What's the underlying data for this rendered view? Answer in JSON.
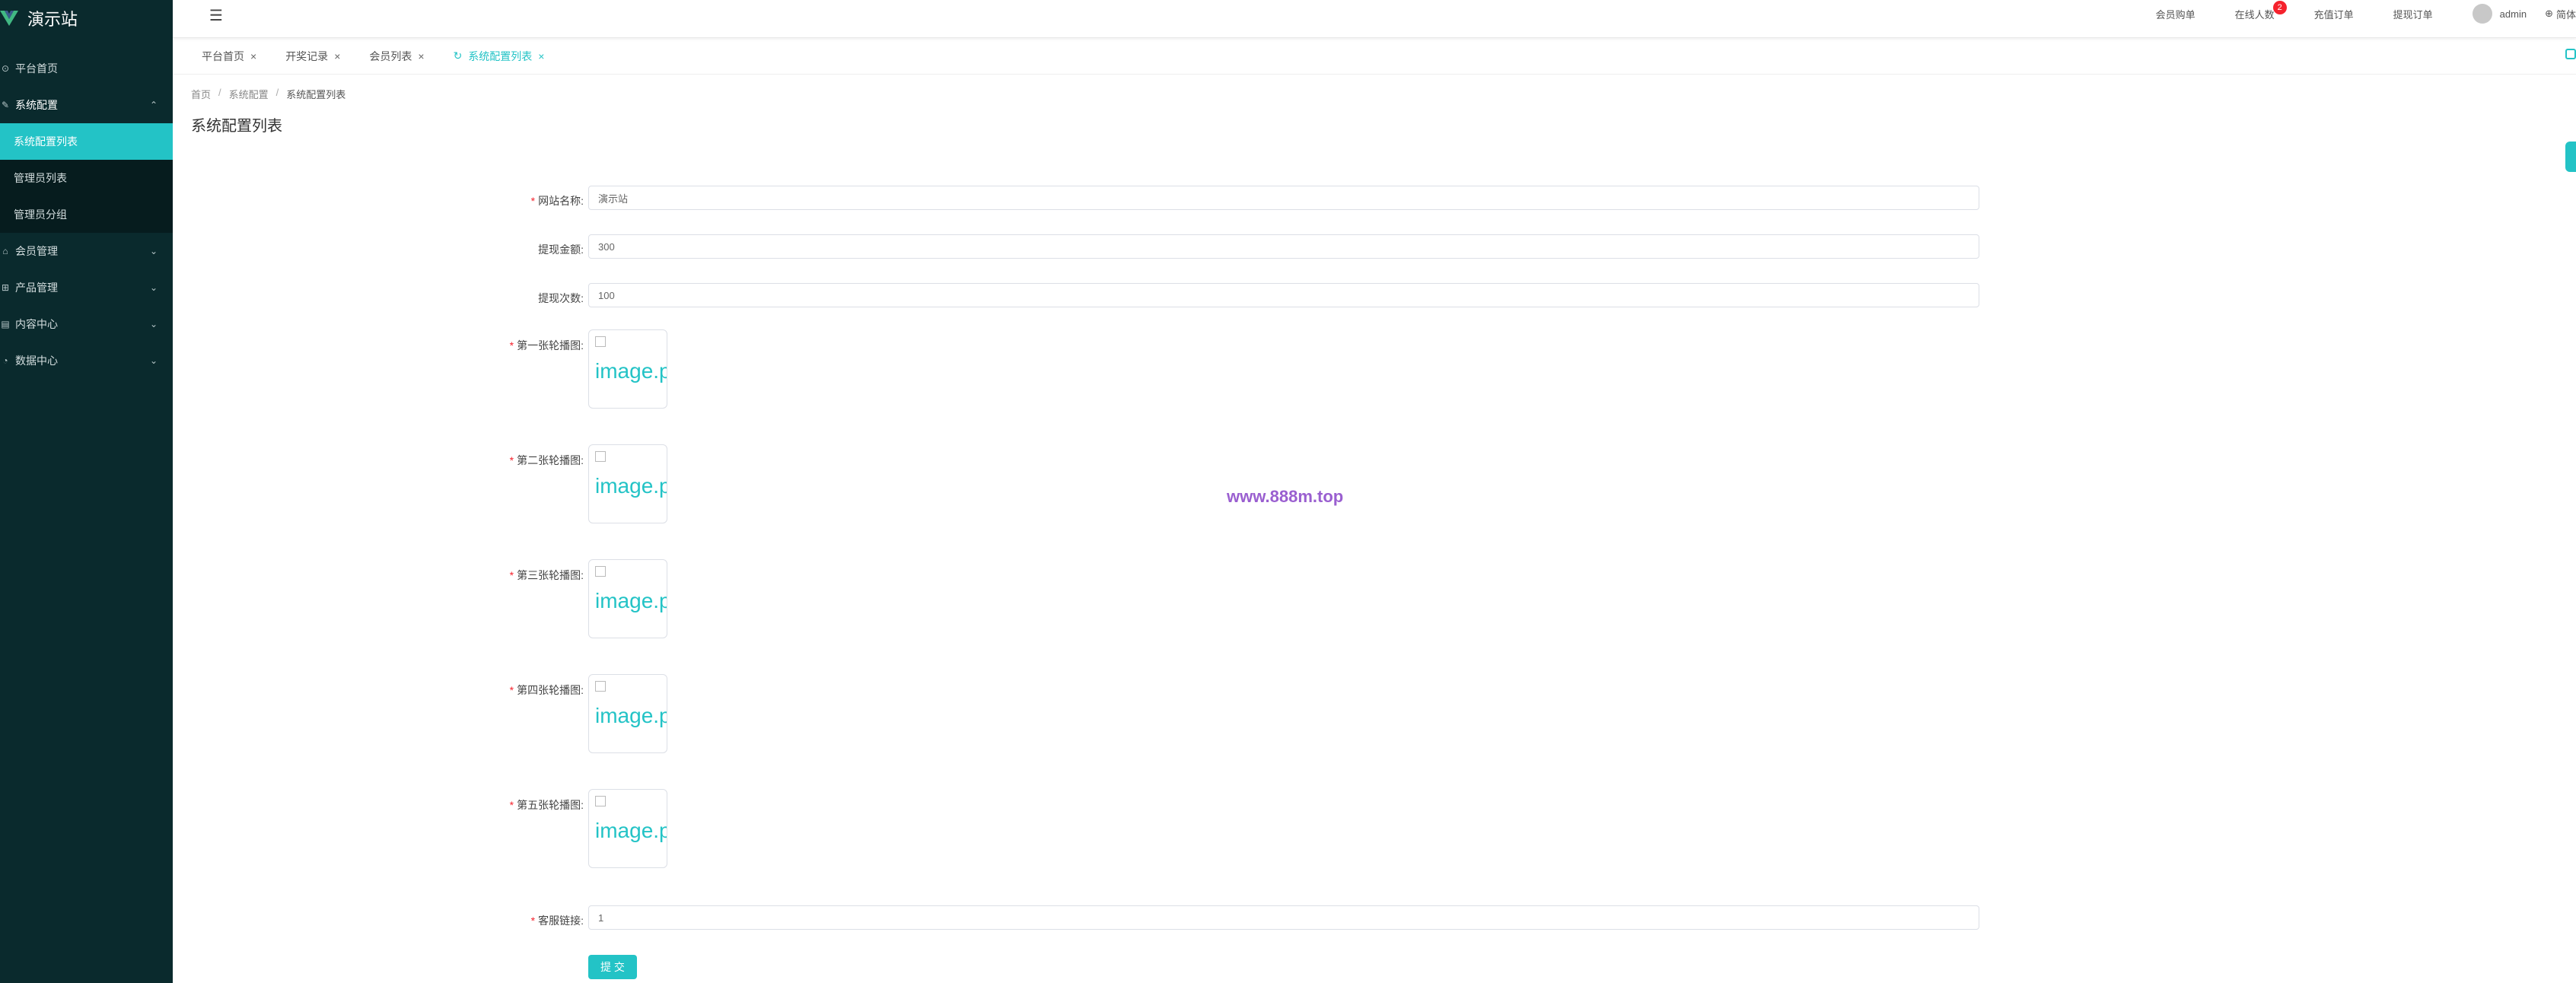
{
  "sidebar": {
    "title": "演示站",
    "items": [
      {
        "label": "平台首页",
        "icon": "home-icon"
      },
      {
        "label": "系统配置",
        "icon": "edit-icon"
      },
      {
        "label": "会员管理",
        "icon": "user-icon"
      },
      {
        "label": "产品管理",
        "icon": "grid-icon"
      },
      {
        "label": "内容中心",
        "icon": "document-icon"
      },
      {
        "label": "数据中心",
        "icon": "chart-icon"
      }
    ],
    "sub_items": [
      {
        "label": "系统配置列表"
      },
      {
        "label": "管理员列表"
      },
      {
        "label": "管理员分组"
      }
    ]
  },
  "header": {
    "links": [
      "会员购单",
      "在线人数",
      "充值订单",
      "提现订单"
    ],
    "online_badge": "2",
    "username": "admin",
    "language": "简体"
  },
  "tabs": [
    {
      "label": "平台首页"
    },
    {
      "label": "开奖记录"
    },
    {
      "label": "会员列表"
    },
    {
      "label": "系统配置列表"
    }
  ],
  "breadcrumb": [
    "首页",
    "系统配置",
    "系统配置列表"
  ],
  "page_title": "系统配置列表",
  "form": {
    "site_name": {
      "label": "网站名称:",
      "value": "演示站"
    },
    "withdraw_amount": {
      "label": "提现金额:",
      "value": "300"
    },
    "withdraw_times": {
      "label": "提现次数:",
      "value": "100"
    },
    "banners": [
      {
        "label": "第一张轮播图:",
        "alt": "image.p"
      },
      {
        "label": "第二张轮播图:",
        "alt": "image.p"
      },
      {
        "label": "第三张轮播图:",
        "alt": "image.p"
      },
      {
        "label": "第四张轮播图:",
        "alt": "image.p"
      },
      {
        "label": "第五张轮播图:",
        "alt": "image.p"
      }
    ],
    "service_link": {
      "label": "客服链接:",
      "value": "1"
    },
    "submit_label": "提 交"
  },
  "watermark": "www.888m.top",
  "colors": {
    "accent": "#23c3c6",
    "sidebar_bg": "#0a2a2d"
  }
}
